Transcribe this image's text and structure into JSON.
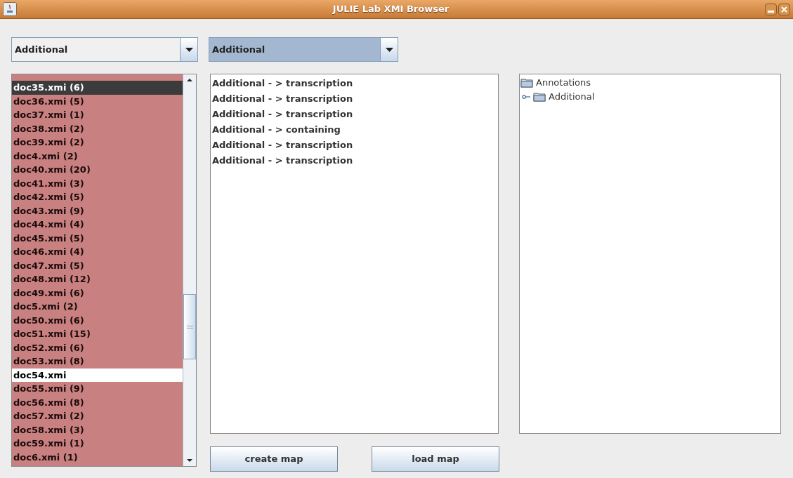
{
  "window": {
    "title": "JULIE Lab XMI Browser"
  },
  "combos": [
    {
      "value": "Additional",
      "focused": false
    },
    {
      "value": "Additional",
      "focused": true
    }
  ],
  "documents": [
    {
      "label": "doc35.xmi (6)",
      "selected": true,
      "annotated": true
    },
    {
      "label": "doc36.xmi (5)",
      "selected": false,
      "annotated": true
    },
    {
      "label": "doc37.xmi (1)",
      "selected": false,
      "annotated": true
    },
    {
      "label": "doc38.xmi (2)",
      "selected": false,
      "annotated": true
    },
    {
      "label": "doc39.xmi (2)",
      "selected": false,
      "annotated": true
    },
    {
      "label": "doc4.xmi (2)",
      "selected": false,
      "annotated": true
    },
    {
      "label": "doc40.xmi (20)",
      "selected": false,
      "annotated": true
    },
    {
      "label": "doc41.xmi (3)",
      "selected": false,
      "annotated": true
    },
    {
      "label": "doc42.xmi (5)",
      "selected": false,
      "annotated": true
    },
    {
      "label": "doc43.xmi (9)",
      "selected": false,
      "annotated": true
    },
    {
      "label": "doc44.xmi (4)",
      "selected": false,
      "annotated": true
    },
    {
      "label": "doc45.xmi (5)",
      "selected": false,
      "annotated": true
    },
    {
      "label": "doc46.xmi (4)",
      "selected": false,
      "annotated": true
    },
    {
      "label": "doc47.xmi (5)",
      "selected": false,
      "annotated": true
    },
    {
      "label": "doc48.xmi (12)",
      "selected": false,
      "annotated": true
    },
    {
      "label": "doc49.xmi (6)",
      "selected": false,
      "annotated": true
    },
    {
      "label": "doc5.xmi (2)",
      "selected": false,
      "annotated": true
    },
    {
      "label": "doc50.xmi (6)",
      "selected": false,
      "annotated": true
    },
    {
      "label": "doc51.xmi (15)",
      "selected": false,
      "annotated": true
    },
    {
      "label": "doc52.xmi (6)",
      "selected": false,
      "annotated": true
    },
    {
      "label": "doc53.xmi (8)",
      "selected": false,
      "annotated": true
    },
    {
      "label": "doc54.xmi",
      "selected": false,
      "annotated": false
    },
    {
      "label": "doc55.xmi (9)",
      "selected": false,
      "annotated": true
    },
    {
      "label": "doc56.xmi (8)",
      "selected": false,
      "annotated": true
    },
    {
      "label": "doc57.xmi (2)",
      "selected": false,
      "annotated": true
    },
    {
      "label": "doc58.xmi (3)",
      "selected": false,
      "annotated": true
    },
    {
      "label": "doc59.xmi (1)",
      "selected": false,
      "annotated": true
    },
    {
      "label": "doc6.xmi (1)",
      "selected": false,
      "annotated": true
    }
  ],
  "relations": [
    "Additional - > transcription",
    "Additional - > transcription",
    "Additional - > transcription",
    "Additional - > containing",
    "Additional - > transcription",
    "Additional - > transcription"
  ],
  "tree": {
    "label": "Annotations",
    "children": [
      {
        "label": "Additional"
      }
    ]
  },
  "buttons": [
    "create map",
    "load map"
  ]
}
